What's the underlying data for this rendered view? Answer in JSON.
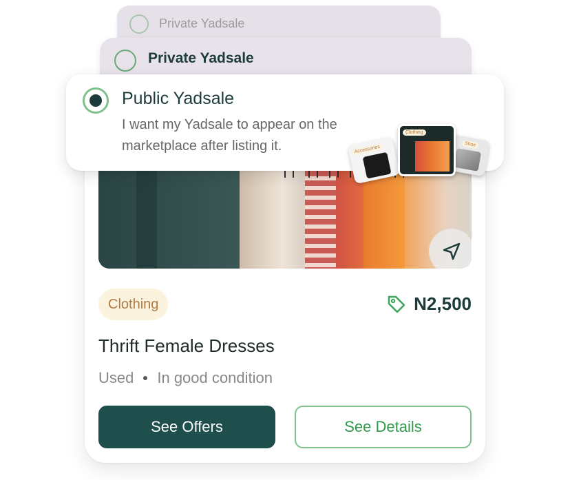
{
  "options": [
    {
      "title": "Private Yadsale",
      "selected": false
    },
    {
      "title": "Private Yadsale",
      "selected": false
    },
    {
      "title": "Public Yadsale",
      "description": "I want my Yadsale to appear on the marketplace after listing it.",
      "selected": true
    }
  ],
  "thumbnails": [
    {
      "label": "Accessories"
    },
    {
      "label": "Clothing"
    },
    {
      "label": "Shoe"
    }
  ],
  "listing": {
    "category": "Clothing",
    "price": "N2,500",
    "title": "Thrift Female Dresses",
    "condition_type": "Used",
    "condition_detail": "In good condition",
    "primary_action": "See Offers",
    "secondary_action": "See Details",
    "share_icon": "send-icon",
    "price_icon": "price-tag-icon"
  },
  "colors": {
    "brand_dark": "#1f4f4d",
    "accent_green": "#2f9a4c",
    "tag_bg": "#fcf3df",
    "tag_text": "#b07a45"
  }
}
